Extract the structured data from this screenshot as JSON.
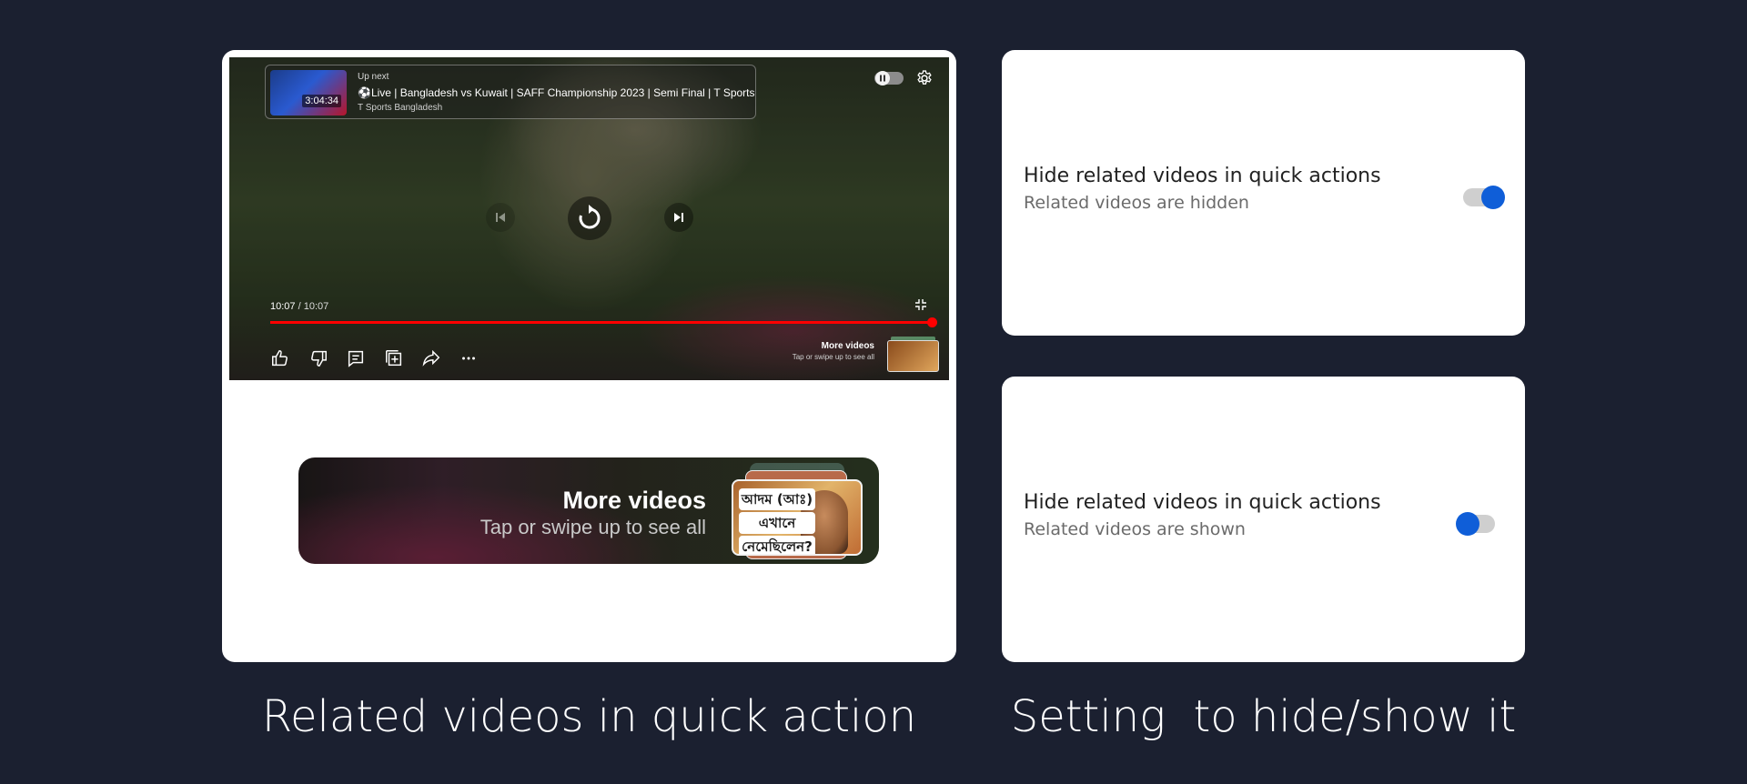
{
  "player": {
    "up_next_label": "Up next",
    "up_next_title": "⚽Live | Bangladesh vs Kuwait | SAFF Championship 2023 | Semi Final | T Sports",
    "up_next_channel": "T Sports Bangladesh",
    "up_next_duration": "3:04:34",
    "time_current": "10:07",
    "time_separator": " / ",
    "time_total": "10:07",
    "progress_fraction": 1.0,
    "more_videos_title": "More videos",
    "more_videos_subtitle": "Tap or swipe up to see all",
    "accent_color": "#ff0000"
  },
  "more_videos_pill": {
    "title": "More videos",
    "subtitle": "Tap or swipe up to see all",
    "thumb_lines": [
      "আদম (আঃ)",
      "এখানে",
      "নেমেছিলেন?"
    ]
  },
  "settings": [
    {
      "title": "Hide related videos in quick actions",
      "subtitle": "Related videos are hidden",
      "enabled": true
    },
    {
      "title": "Hide related videos in quick actions",
      "subtitle": "Related videos are shown",
      "enabled": false
    }
  ],
  "captions": {
    "left": "Related videos in quick action",
    "right": "Setting  to hide/show it"
  },
  "colors": {
    "background": "#1b2030",
    "switch_accent": "#0f5ed8"
  },
  "icons": [
    "settings-icon",
    "prev-icon",
    "replay-icon",
    "next-icon",
    "minimize-icon",
    "like-icon",
    "dislike-icon",
    "comments-icon",
    "save-to-playlist-icon",
    "share-icon",
    "more-icon"
  ]
}
